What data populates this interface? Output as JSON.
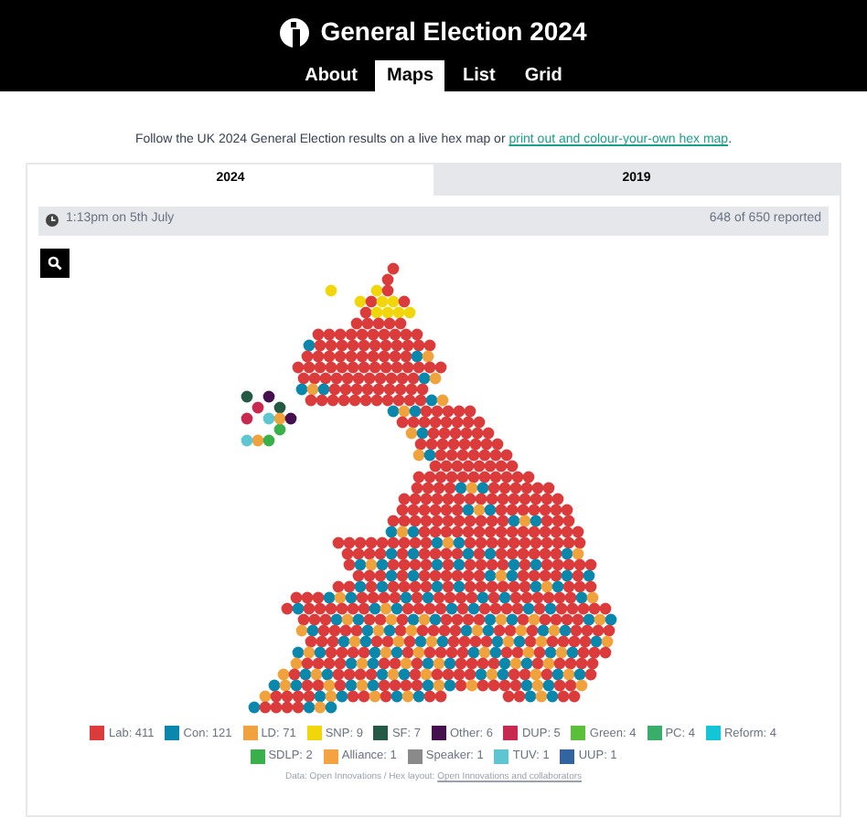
{
  "header": {
    "title": "General Election 2024"
  },
  "nav": [
    {
      "label": "About",
      "selected": false
    },
    {
      "label": "Maps",
      "selected": true
    },
    {
      "label": "List",
      "selected": false
    },
    {
      "label": "Grid",
      "selected": false
    }
  ],
  "intro": {
    "text": "Follow the UK 2024 General Election results on a live hex map or ",
    "link": "print out and colour-your-own hex map",
    "after": "."
  },
  "year_tabs": [
    {
      "label": "2024",
      "selected": true
    },
    {
      "label": "2019",
      "selected": false
    }
  ],
  "status_bar": {
    "time": "1:13pm on 5th July",
    "reported": "648 of 650 reported"
  },
  "legend": [
    {
      "label": "Lab: 411",
      "color": "#dc3b3b"
    },
    {
      "label": "Con: 121",
      "color": "#0a87ad"
    },
    {
      "label": "LD: 71",
      "color": "#f0a23c"
    },
    {
      "label": "SNP: 9",
      "color": "#f2d60c"
    },
    {
      "label": "SF: 7",
      "color": "#245a45"
    },
    {
      "label": "Other: 6",
      "color": "#45104e"
    },
    {
      "label": "DUP: 5",
      "color": "#c7294f"
    },
    {
      "label": "Green: 4",
      "color": "#5bbf3a"
    },
    {
      "label": "PC: 4",
      "color": "#3aad6b"
    },
    {
      "label": "Reform: 4",
      "color": "#12c6d8"
    },
    {
      "label": "SDLP: 2",
      "color": "#3ab04a"
    },
    {
      "label": "Alliance: 1",
      "color": "#f4a340"
    },
    {
      "label": "Speaker: 1",
      "color": "#8a8a8a"
    },
    {
      "label": "TUV: 1",
      "color": "#5ec6d1"
    },
    {
      "label": "UUP: 1",
      "color": "#3364a0"
    }
  ],
  "source": {
    "text": "Data: Open Innovations / Hex layout: ",
    "link": "Open Innovations and collaborators"
  }
}
